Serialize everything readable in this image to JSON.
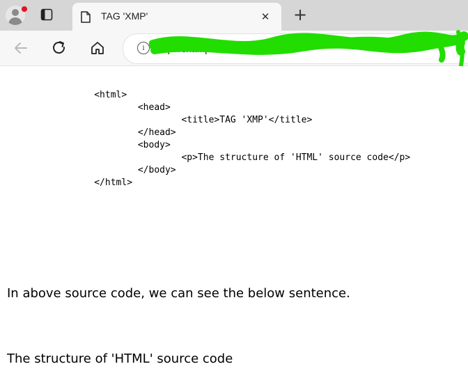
{
  "browser": {
    "tab": {
      "title": "TAG 'XMP'",
      "close_glyph": "✕"
    },
    "new_tab_glyph": "+",
    "address_bar": {
      "url": "http://example.local/xmp.html",
      "url_redacted": true
    },
    "icons": {
      "profile": "profile-avatar-icon",
      "tabs": "tab-actions-icon",
      "page": "document-icon",
      "back": "back-arrow-icon",
      "reload": "reload-icon",
      "home": "home-icon",
      "info": "info-icon"
    },
    "colors": {
      "notification_dot": "#e81123",
      "redaction": "#22dd00"
    }
  },
  "page": {
    "source_lines": [
      "\t\t<html>",
      "\t\t\t<head>",
      "\t\t\t\t<title>TAG 'XMP'</title>",
      "\t\t\t</head>",
      "\t\t\t<body>",
      "\t\t\t\t<p>The structure of 'HTML' source code</p>",
      "\t\t\t</body>",
      "\t\t</html>"
    ],
    "paragraph_1": "In above source code, we can see the below sentence.",
    "paragraph_2": "The structure of 'HTML' source code"
  }
}
